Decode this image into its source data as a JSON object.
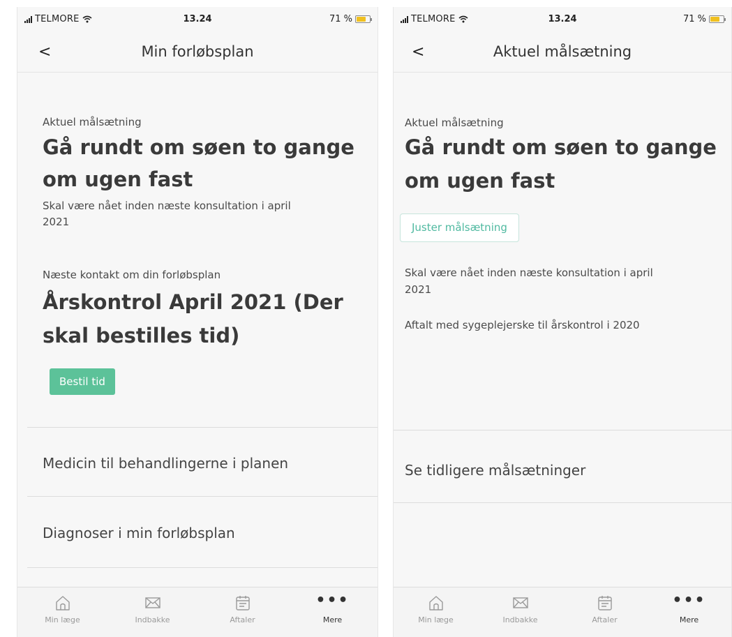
{
  "left": {
    "status": {
      "carrier": "TELMORE",
      "time": "13.24",
      "battery": "71 %"
    },
    "nav": {
      "back": "<",
      "title": "Min forløbsplan"
    },
    "goal": {
      "label": "Aktuel målsætning",
      "title_line1": "Gå rundt om søen to gange",
      "title_line2": "om ugen fast",
      "note_line1": "Skal være nået inden næste konsultation i april",
      "note_line2": "2021"
    },
    "contact": {
      "label": "Næste kontakt om din forløbsplan",
      "title_line1": "Årskontrol April 2021 (Der",
      "title_line2": "skal bestilles tid)",
      "button": "Bestil tid"
    },
    "menu": [
      "Medicin til behandlingerne i planen",
      "Diagnoser i min forløbsplan"
    ]
  },
  "right": {
    "status": {
      "carrier": "TELMORE",
      "time": "13.24",
      "battery": "71 %"
    },
    "nav": {
      "back": "<",
      "title": "Aktuel målsætning"
    },
    "goal": {
      "label": "Aktuel målsætning",
      "title_line1": "Gå rundt om søen to gange",
      "title_line2": "om ugen fast",
      "button": "Juster målsætning",
      "note_line1": "Skal være nået inden næste konsultation i april",
      "note_line2": "2021",
      "agreed": "Aftalt med sygeplejerske til årskontrol i 2020"
    },
    "menu": [
      "Se tidligere målsætninger"
    ]
  },
  "tabbar": {
    "tabs": [
      {
        "label": "Min læge",
        "icon": "home-icon"
      },
      {
        "label": "Indbakke",
        "icon": "mail-icon"
      },
      {
        "label": "Aftaler",
        "icon": "calendar-icon"
      },
      {
        "label": "Mere",
        "icon": "more-icon"
      }
    ]
  },
  "colors": {
    "accent_green": "#5cc299",
    "accent_teal_text": "#4fb9a0",
    "battery": "#f0c020"
  }
}
